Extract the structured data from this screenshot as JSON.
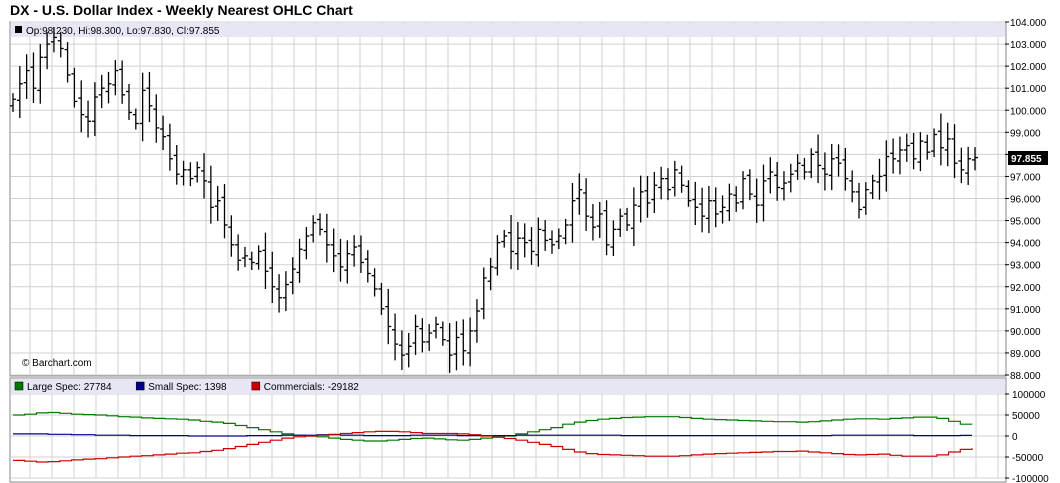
{
  "title": "DX - U.S. Dollar Index - Weekly Nearest OHLC Chart",
  "ohlc_label": "Op:98.230, Hi:98.300, Lo:97.830, Cl:97.855",
  "last_price_label": "97.855",
  "watermark": "© Barchart.com",
  "colors": {
    "price_bar": "#000000",
    "grid": "#d0d0d0",
    "header_band": "#e6e6f5",
    "large_spec": "#007700",
    "small_spec": "#00008b",
    "commercials": "#cc0000"
  },
  "cot_legend": [
    {
      "name": "Large Spec: 27784",
      "color": "#007700"
    },
    {
      "name": "Small Spec: 1398",
      "color": "#00008b"
    },
    {
      "name": "Commercials: -29182",
      "color": "#cc0000"
    }
  ],
  "chart_data": [
    {
      "type": "ohlc",
      "ylim": [
        88,
        104
      ],
      "yticks": [
        "104.000",
        "103.000",
        "102.000",
        "101.000",
        "100.000",
        "99.000",
        "98.000",
        "97.000",
        "96.000",
        "95.000",
        "94.000",
        "93.000",
        "92.000",
        "91.000",
        "90.000",
        "89.000",
        "88.000"
      ],
      "closes": [
        100.5,
        101.2,
        101.8,
        101.0,
        102.4,
        103.0,
        103.3,
        102.8,
        101.6,
        100.4,
        99.8,
        99.5,
        100.6,
        101.0,
        101.2,
        101.8,
        100.7,
        99.9,
        99.4,
        100.9,
        100.2,
        99.2,
        98.8,
        97.8,
        97.1,
        97.3,
        96.9,
        97.4,
        96.8,
        95.6,
        95.9,
        94.8,
        93.9,
        93.2,
        93.4,
        93.1,
        93.6,
        92.7,
        92.0,
        91.5,
        92.1,
        92.8,
        93.7,
        94.3,
        94.9,
        94.6,
        93.9,
        93.4,
        92.9,
        93.5,
        93.8,
        93.1,
        92.6,
        91.9,
        91.0,
        90.2,
        89.4,
        88.9,
        89.3,
        90.2,
        89.5,
        89.9,
        90.3,
        89.6,
        88.9,
        89.7,
        89.1,
        90.0,
        90.9,
        92.4,
        92.9,
        94.0,
        94.3,
        93.6,
        94.2,
        94.0,
        93.6,
        94.6,
        94.1,
        93.9,
        94.3,
        94.8,
        95.9,
        96.4,
        95.2,
        94.7,
        95.3,
        93.9,
        94.6,
        95.2,
        94.8,
        95.7,
        96.3,
        95.8,
        96.6,
        96.9,
        96.4,
        97.3,
        96.6,
        95.9,
        95.6,
        95.2,
        95.9,
        95.3,
        95.6,
        96.2,
        95.8,
        96.9,
        96.2,
        95.7,
        96.8,
        97.2,
        96.5,
        96.7,
        97.1,
        97.6,
        97.2,
        98.0,
        97.5,
        97.1,
        97.8,
        97.6,
        96.9,
        96.3,
        95.5,
        96.4,
        96.8,
        97.0,
        97.9,
        97.8,
        98.2,
        98.4,
        97.8,
        98.6,
        98.1,
        98.9,
        98.3,
        98.7,
        97.6,
        97.3,
        97.8,
        97.855
      ],
      "cot": {
        "ylim": [
          -100000,
          100000
        ],
        "yticks": [
          "100000",
          "50000",
          "0",
          "-50000",
          "-100000"
        ],
        "series": [
          {
            "name": "Large Spec",
            "color": "#007700",
            "values": [
              50000,
              52000,
              55000,
              56000,
              54000,
              52000,
              51000,
              50000,
              48000,
              46000,
              45000,
              43000,
              42000,
              41000,
              40000,
              38000,
              35000,
              33000,
              30000,
              25000,
              20000,
              15000,
              10000,
              5000,
              2000,
              0,
              -2000,
              -5000,
              -8000,
              -10000,
              -12000,
              -12000,
              -10000,
              -8000,
              -6000,
              -5000,
              -7000,
              -9000,
              -10000,
              -8000,
              -5000,
              -2000,
              0,
              5000,
              10000,
              15000,
              20000,
              28000,
              33000,
              37000,
              40000,
              42000,
              44000,
              45000,
              46000,
              46000,
              46000,
              44000,
              42000,
              40000,
              39000,
              38000,
              37000,
              36000,
              35000,
              34000,
              34000,
              33000,
              34000,
              36000,
              38000,
              40000,
              41000,
              41000,
              40000,
              42000,
              43000,
              45000,
              45000,
              42000,
              35000,
              28000,
              27784
            ]
          },
          {
            "name": "Small Spec",
            "color": "#00008b",
            "values": [
              5000,
              5000,
              5000,
              4000,
              4000,
              3000,
              3000,
              2000,
              2000,
              2000,
              1000,
              1000,
              1000,
              1000,
              1000,
              0,
              0,
              0,
              0,
              0,
              1000,
              1000,
              1000,
              2000,
              2000,
              2000,
              3000,
              3000,
              2000,
              2000,
              1000,
              1000,
              1000,
              1000,
              2000,
              2000,
              2000,
              2000,
              1000,
              1000,
              1000,
              1000,
              1000,
              2000,
              2000,
              2000,
              2000,
              2000,
              2000,
              2000,
              2000,
              2000,
              1000,
              1000,
              1000,
              1000,
              1000,
              1000,
              1000,
              1000,
              1000,
              1000,
              1000,
              1000,
              1000,
              1000,
              1000,
              1000,
              1000,
              1000,
              2000,
              2000,
              2000,
              2000,
              2000,
              2000,
              2000,
              1000,
              1000,
              1000,
              1000,
              1398,
              1398
            ]
          },
          {
            "name": "Commercials",
            "color": "#cc0000",
            "values": [
              -58000,
              -60000,
              -62000,
              -61000,
              -59000,
              -57000,
              -55000,
              -54000,
              -52000,
              -50000,
              -48000,
              -47000,
              -45000,
              -43000,
              -41000,
              -40000,
              -37000,
              -34000,
              -30000,
              -25000,
              -20000,
              -15000,
              -10000,
              -5000,
              -2000,
              0,
              2000,
              4000,
              6000,
              8000,
              10000,
              11000,
              11000,
              10000,
              8000,
              6000,
              6000,
              6000,
              5000,
              3000,
              0,
              -3000,
              -6000,
              -10000,
              -15000,
              -20000,
              -25000,
              -32000,
              -38000,
              -42000,
              -44000,
              -45000,
              -46000,
              -47000,
              -48000,
              -48000,
              -48000,
              -47000,
              -45000,
              -43000,
              -42000,
              -41000,
              -40000,
              -39000,
              -38000,
              -37000,
              -37000,
              -36000,
              -38000,
              -40000,
              -42000,
              -44000,
              -45000,
              -44000,
              -43000,
              -46000,
              -48000,
              -48000,
              -48000,
              -45000,
              -38000,
              -32000,
              -29182
            ]
          }
        ]
      }
    }
  ]
}
